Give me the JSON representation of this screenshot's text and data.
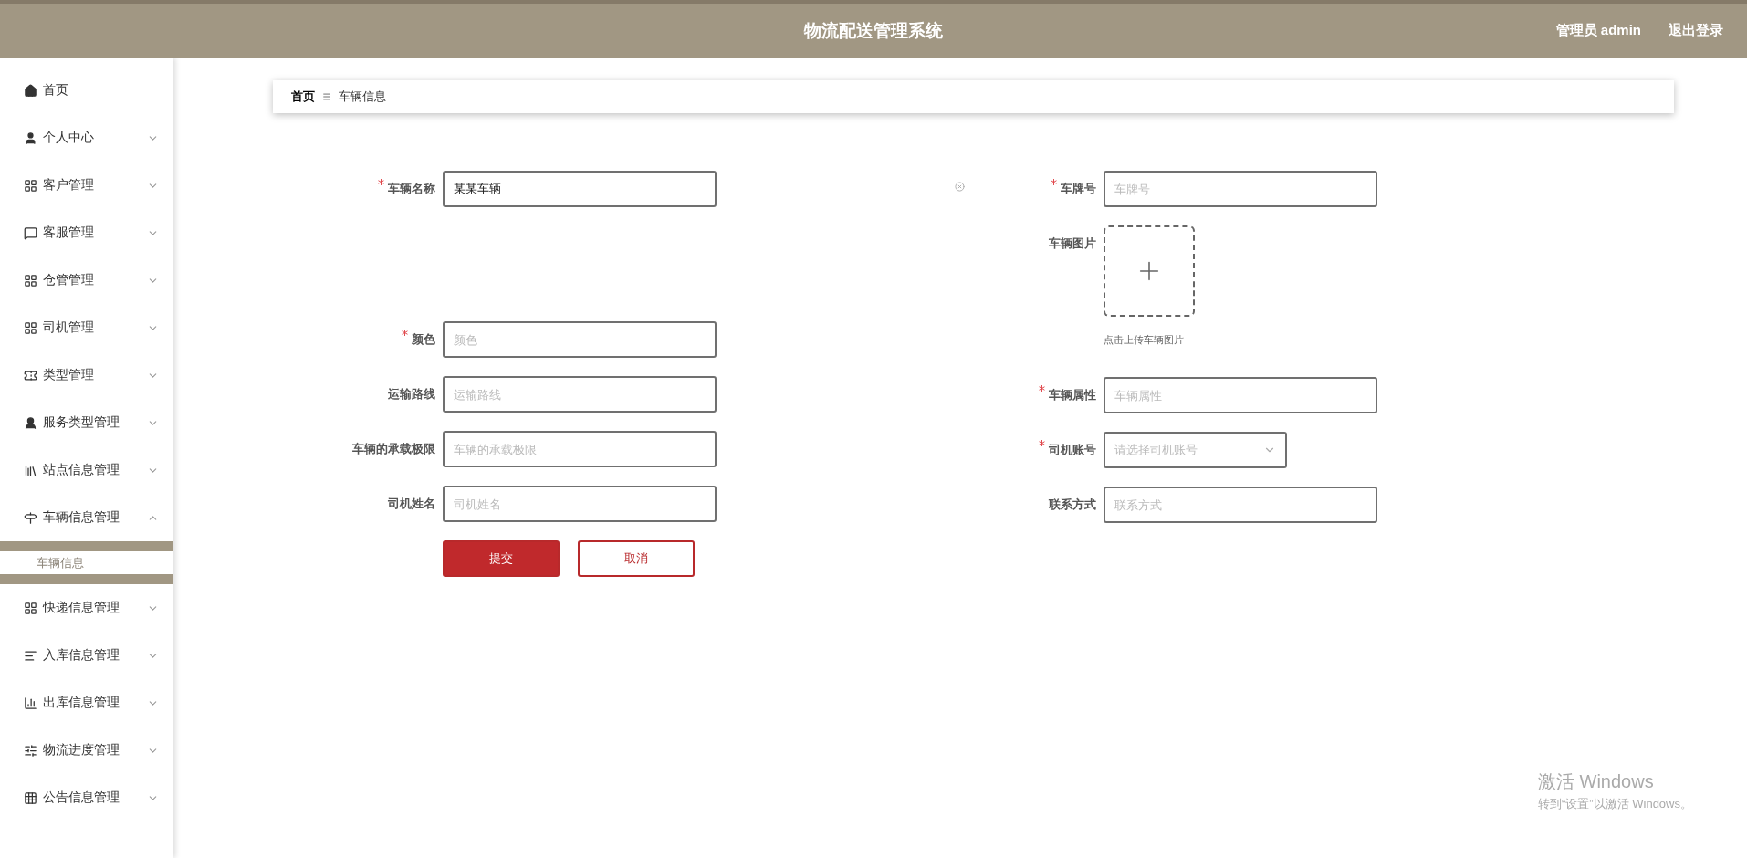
{
  "header": {
    "title": "物流配送管理系统",
    "user": "管理员 admin",
    "logout": "退出登录"
  },
  "sidebar": {
    "items": [
      {
        "label": "首页"
      },
      {
        "label": "个人中心",
        "expanded": false
      },
      {
        "label": "客户管理",
        "expanded": false
      },
      {
        "label": "客服管理",
        "expanded": false
      },
      {
        "label": "仓管管理",
        "expanded": false
      },
      {
        "label": "司机管理",
        "expanded": false
      },
      {
        "label": "类型管理",
        "expanded": false
      },
      {
        "label": "服务类型管理",
        "expanded": false
      },
      {
        "label": "站点信息管理",
        "expanded": false
      },
      {
        "label": "车辆信息管理",
        "expanded": true,
        "children": [
          {
            "label": "车辆信息",
            "selected": true
          }
        ]
      },
      {
        "label": "快递信息管理",
        "expanded": false
      },
      {
        "label": "入库信息管理",
        "expanded": false
      },
      {
        "label": "出库信息管理",
        "expanded": false
      },
      {
        "label": "物流进度管理",
        "expanded": false
      },
      {
        "label": "公告信息管理",
        "expanded": false
      }
    ]
  },
  "breadcrumb": [
    "首页",
    "车辆信息"
  ],
  "form": {
    "left_fields": [
      {
        "kind": "text",
        "label": "车辆名称",
        "required": true,
        "value": "某某车辆"
      },
      {
        "kind": "text",
        "label": "颜色",
        "required": true,
        "placeholder": "颜色"
      },
      {
        "kind": "text",
        "label": "运输路线",
        "required": false,
        "placeholder": "运输路线"
      },
      {
        "kind": "text",
        "label": "车辆的承载极限",
        "required": false,
        "placeholder": "车辆的承载极限"
      },
      {
        "kind": "text",
        "label": "司机姓名",
        "required": false,
        "placeholder": "司机姓名"
      }
    ],
    "right_fields": [
      {
        "kind": "text",
        "label": "车牌号",
        "required": true,
        "placeholder": "车牌号"
      },
      {
        "kind": "upload",
        "label": "车辆图片",
        "required": false,
        "hint": "点击上传车辆图片"
      },
      {
        "kind": "text",
        "label": "车辆属性",
        "required": true,
        "placeholder": "车辆属性"
      },
      {
        "kind": "select",
        "label": "司机账号",
        "required": true,
        "placeholder": "请选择司机账号"
      },
      {
        "kind": "text",
        "label": "联系方式",
        "required": false,
        "placeholder": "联系方式"
      }
    ],
    "buttons": [
      {
        "kind": "primary",
        "label": "提交"
      },
      {
        "kind": "outline",
        "label": "取消"
      }
    ]
  },
  "os_watermark": {
    "title": "激活 Windows",
    "subtitle": "转到“设置”以激活 Windows。"
  }
}
